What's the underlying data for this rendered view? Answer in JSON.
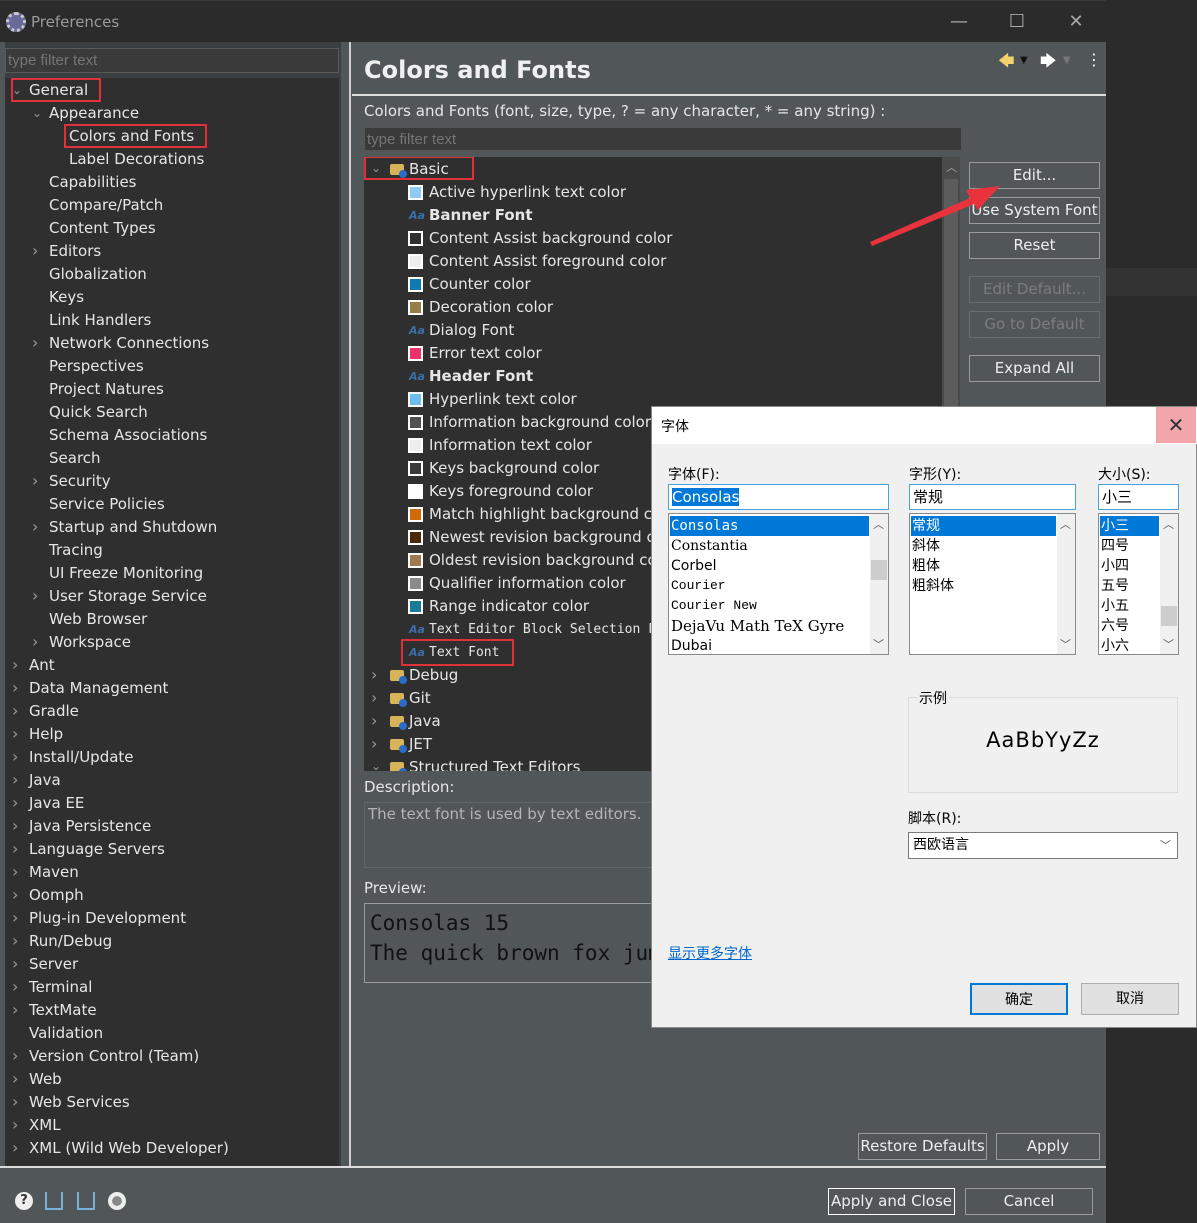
{
  "window": {
    "title": "Preferences",
    "minimize": "—",
    "maximize": "☐",
    "close": "✕"
  },
  "left": {
    "filter_placeholder": "type filter text",
    "tree": [
      {
        "label": "General",
        "level": 0,
        "chev": "open",
        "hl": true
      },
      {
        "label": "Appearance",
        "level": 1,
        "chev": "open"
      },
      {
        "label": "Colors and Fonts",
        "level": 2,
        "chev": "",
        "hl": true,
        "selected": true
      },
      {
        "label": "Label Decorations",
        "level": 2,
        "chev": ""
      },
      {
        "label": "Capabilities",
        "level": 1,
        "chev": ""
      },
      {
        "label": "Compare/Patch",
        "level": 1,
        "chev": ""
      },
      {
        "label": "Content Types",
        "level": 1,
        "chev": ""
      },
      {
        "label": "Editors",
        "level": 1,
        "chev": "closed"
      },
      {
        "label": "Globalization",
        "level": 1,
        "chev": ""
      },
      {
        "label": "Keys",
        "level": 1,
        "chev": ""
      },
      {
        "label": "Link Handlers",
        "level": 1,
        "chev": ""
      },
      {
        "label": "Network Connections",
        "level": 1,
        "chev": "closed"
      },
      {
        "label": "Perspectives",
        "level": 1,
        "chev": ""
      },
      {
        "label": "Project Natures",
        "level": 1,
        "chev": ""
      },
      {
        "label": "Quick Search",
        "level": 1,
        "chev": ""
      },
      {
        "label": "Schema Associations",
        "level": 1,
        "chev": ""
      },
      {
        "label": "Search",
        "level": 1,
        "chev": ""
      },
      {
        "label": "Security",
        "level": 1,
        "chev": "closed"
      },
      {
        "label": "Service Policies",
        "level": 1,
        "chev": ""
      },
      {
        "label": "Startup and Shutdown",
        "level": 1,
        "chev": "closed"
      },
      {
        "label": "Tracing",
        "level": 1,
        "chev": ""
      },
      {
        "label": "UI Freeze Monitoring",
        "level": 1,
        "chev": ""
      },
      {
        "label": "User Storage Service",
        "level": 1,
        "chev": "closed"
      },
      {
        "label": "Web Browser",
        "level": 1,
        "chev": ""
      },
      {
        "label": "Workspace",
        "level": 1,
        "chev": "closed"
      },
      {
        "label": "Ant",
        "level": 0,
        "chev": "closed"
      },
      {
        "label": "Data Management",
        "level": 0,
        "chev": "closed"
      },
      {
        "label": "Gradle",
        "level": 0,
        "chev": "closed"
      },
      {
        "label": "Help",
        "level": 0,
        "chev": "closed"
      },
      {
        "label": "Install/Update",
        "level": 0,
        "chev": "closed"
      },
      {
        "label": "Java",
        "level": 0,
        "chev": "closed"
      },
      {
        "label": "Java EE",
        "level": 0,
        "chev": "closed"
      },
      {
        "label": "Java Persistence",
        "level": 0,
        "chev": "closed"
      },
      {
        "label": "Language Servers",
        "level": 0,
        "chev": "closed"
      },
      {
        "label": "Maven",
        "level": 0,
        "chev": "closed"
      },
      {
        "label": "Oomph",
        "level": 0,
        "chev": "closed"
      },
      {
        "label": "Plug-in Development",
        "level": 0,
        "chev": "closed"
      },
      {
        "label": "Run/Debug",
        "level": 0,
        "chev": "closed"
      },
      {
        "label": "Server",
        "level": 0,
        "chev": "closed"
      },
      {
        "label": "Terminal",
        "level": 0,
        "chev": "closed"
      },
      {
        "label": "TextMate",
        "level": 0,
        "chev": "closed"
      },
      {
        "label": "Validation",
        "level": 0,
        "chev": ""
      },
      {
        "label": "Version Control (Team)",
        "level": 0,
        "chev": "closed"
      },
      {
        "label": "Web",
        "level": 0,
        "chev": "closed"
      },
      {
        "label": "Web Services",
        "level": 0,
        "chev": "closed"
      },
      {
        "label": "XML",
        "level": 0,
        "chev": "closed"
      },
      {
        "label": "XML (Wild Web Developer)",
        "level": 0,
        "chev": "closed"
      }
    ]
  },
  "main": {
    "title": "Colors and Fonts",
    "subtitle": "Colors and Fonts (font, size, type, ? = any character, * = any string) :",
    "filter_placeholder": "type filter text",
    "nav": {
      "back": "back-arrow-icon",
      "forward": "forward-arrow-icon",
      "menu": "more-icon"
    },
    "categories_before": [
      {
        "label": "Basic",
        "open": true
      }
    ],
    "basic_items": [
      {
        "label": "Active hyperlink text color",
        "type": "color",
        "color": "#8ecbf5"
      },
      {
        "label": "Banner Font",
        "type": "font",
        "bold": true
      },
      {
        "label": "Content Assist background color",
        "type": "color",
        "color": "#2f2f2f"
      },
      {
        "label": "Content Assist foreground color",
        "type": "color",
        "color": "#eeeeee"
      },
      {
        "label": "Counter color",
        "type": "color",
        "color": "#0e7bb0"
      },
      {
        "label": "Decoration color",
        "type": "color",
        "color": "#957f48"
      },
      {
        "label": "Dialog Font",
        "type": "font"
      },
      {
        "label": "Error text color",
        "type": "color",
        "color": "#f0306a"
      },
      {
        "label": "Header Font",
        "type": "font",
        "bold": true
      },
      {
        "label": "Hyperlink text color",
        "type": "color",
        "color": "#6ebff0"
      },
      {
        "label": "Information background color",
        "type": "color",
        "color": "#505050"
      },
      {
        "label": "Information text color",
        "type": "color",
        "color": "#eeeeee"
      },
      {
        "label": "Keys background color",
        "type": "color",
        "color": "#3a3a3a"
      },
      {
        "label": "Keys foreground color",
        "type": "color",
        "color": "#ffffff"
      },
      {
        "label": "Match highlight background color",
        "type": "color",
        "color": "#d06a08"
      },
      {
        "label": "Newest revision background color",
        "type": "color",
        "color": "#4a2a08"
      },
      {
        "label": "Oldest revision background color",
        "type": "color",
        "color": "#a07a4a"
      },
      {
        "label": "Qualifier information color",
        "type": "color",
        "color": "#8a8a8a"
      },
      {
        "label": "Range indicator color",
        "type": "color",
        "color": "#1a7a9a"
      },
      {
        "label": "Text Editor Block Selection Font",
        "type": "font",
        "mono": true
      },
      {
        "label": "Text Font",
        "type": "font",
        "mono": true,
        "hl": true
      }
    ],
    "categories_after": [
      {
        "label": "Debug",
        "open": false
      },
      {
        "label": "Git",
        "open": false
      },
      {
        "label": "Java",
        "open": false
      },
      {
        "label": "JET",
        "open": false
      },
      {
        "label": "Structured Text Editors",
        "open": true
      }
    ],
    "buttons": {
      "edit": "Edit...",
      "use_system_font": "Use System Font",
      "reset": "Reset",
      "edit_default": "Edit Default...",
      "go_to_default": "Go to Default",
      "expand_all": "Expand All"
    },
    "description_label": "Description:",
    "description": "The text font is used by text editors.",
    "preview_label": "Preview:",
    "preview_lines": [
      "Consolas 15",
      "The quick brown fox jumps over the lazy dog."
    ],
    "restore_defaults": "Restore Defaults",
    "apply": "Apply"
  },
  "footer": {
    "apply_and_close": "Apply and Close",
    "cancel": "Cancel",
    "icons": [
      "help-icon",
      "import-icon",
      "export-icon",
      "record-icon"
    ]
  },
  "font_dialog": {
    "title": "字体",
    "font_label": "字体(F):",
    "font_value": "Consolas",
    "fonts": [
      "Consolas",
      "Constantia",
      "Corbel",
      "Courier",
      "Courier New",
      "DejaVu Math TeX Gyre",
      "Dubai"
    ],
    "style_label": "字形(Y):",
    "style_value": "常规",
    "styles": [
      "常规",
      "斜体",
      "粗体",
      "粗斜体"
    ],
    "size_label": "大小(S):",
    "size_value": "小三",
    "sizes": [
      "小三",
      "四号",
      "小四",
      "五号",
      "小五",
      "六号",
      "小六"
    ],
    "sample_label": "示例",
    "sample_text": "AaBbYyZz",
    "script_label": "脚本(R):",
    "script_value": "西欧语言",
    "more_fonts": "显示更多字体",
    "ok": "确定",
    "cancel": "取消"
  },
  "colors": {
    "highlight_box": "#e0303a",
    "selection": "#0078d7",
    "annotation_arrow": "#e8323c"
  }
}
